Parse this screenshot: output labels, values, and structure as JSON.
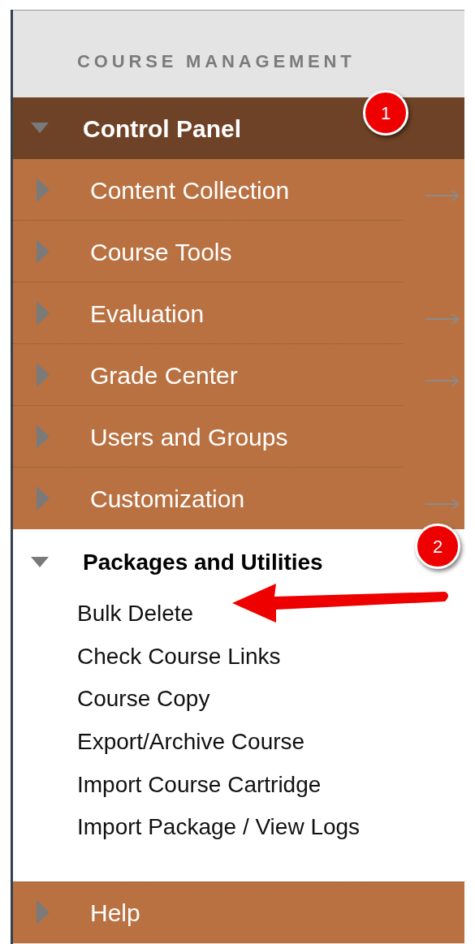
{
  "header": {
    "title": "COURSE MANAGEMENT"
  },
  "control_panel": {
    "label": "Control Panel",
    "expanded": true,
    "items": [
      {
        "label": "Content Collection",
        "expanded": false,
        "has_arrow": true
      },
      {
        "label": "Course Tools",
        "expanded": false,
        "has_arrow": false
      },
      {
        "label": "Evaluation",
        "expanded": false,
        "has_arrow": true
      },
      {
        "label": "Grade Center",
        "expanded": false,
        "has_arrow": true
      },
      {
        "label": "Users and Groups",
        "expanded": false,
        "has_arrow": false
      },
      {
        "label": "Customization",
        "expanded": false,
        "has_arrow": true
      }
    ]
  },
  "packages": {
    "label": "Packages and Utilities",
    "expanded": true,
    "items": [
      "Bulk Delete",
      "Check Course Links",
      "Course Copy",
      "Export/Archive Course",
      "Import Course Cartridge",
      "Import Package / View Logs"
    ]
  },
  "help": {
    "label": "Help",
    "expanded": false
  },
  "callouts": [
    "1",
    "2"
  ]
}
